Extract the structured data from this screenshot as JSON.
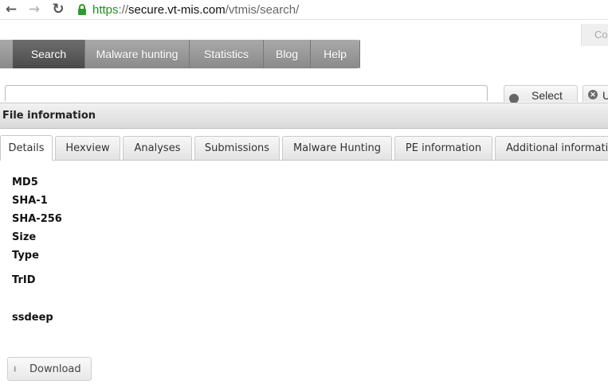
{
  "browser": {
    "url_scheme": "https",
    "url_sep": "://",
    "url_host": "secure.vt-mis.com",
    "url_path": "/vtmis/search/"
  },
  "top_right": {
    "text": "Co"
  },
  "nav": {
    "items": [
      {
        "label": "Search",
        "active": true
      },
      {
        "label": "Malware hunting",
        "active": false
      },
      {
        "label": "Statistics",
        "active": false
      },
      {
        "label": "Blog",
        "active": false
      },
      {
        "label": "Help",
        "active": false
      }
    ]
  },
  "search": {
    "input_value": "",
    "select_label": "Select",
    "unselect_label": "U"
  },
  "panel": {
    "title": "File information"
  },
  "tabs": [
    {
      "label": "Details",
      "active": true
    },
    {
      "label": "Hexview",
      "active": false
    },
    {
      "label": "Analyses",
      "active": false
    },
    {
      "label": "Submissions",
      "active": false
    },
    {
      "label": "Malware Hunting",
      "active": false
    },
    {
      "label": "PE information",
      "active": false
    },
    {
      "label": "Additional information",
      "active": false
    }
  ],
  "details": {
    "fields": [
      "MD5",
      "SHA-1",
      "SHA-256",
      "Size",
      "Type",
      "TrID",
      "ssdeep"
    ]
  },
  "download": {
    "label": "Download",
    "icon_glyph": "⭳"
  },
  "colors": {
    "secure_green": "#1f8f1f",
    "nav_active": "#555555",
    "nav_bg": "#999999"
  }
}
